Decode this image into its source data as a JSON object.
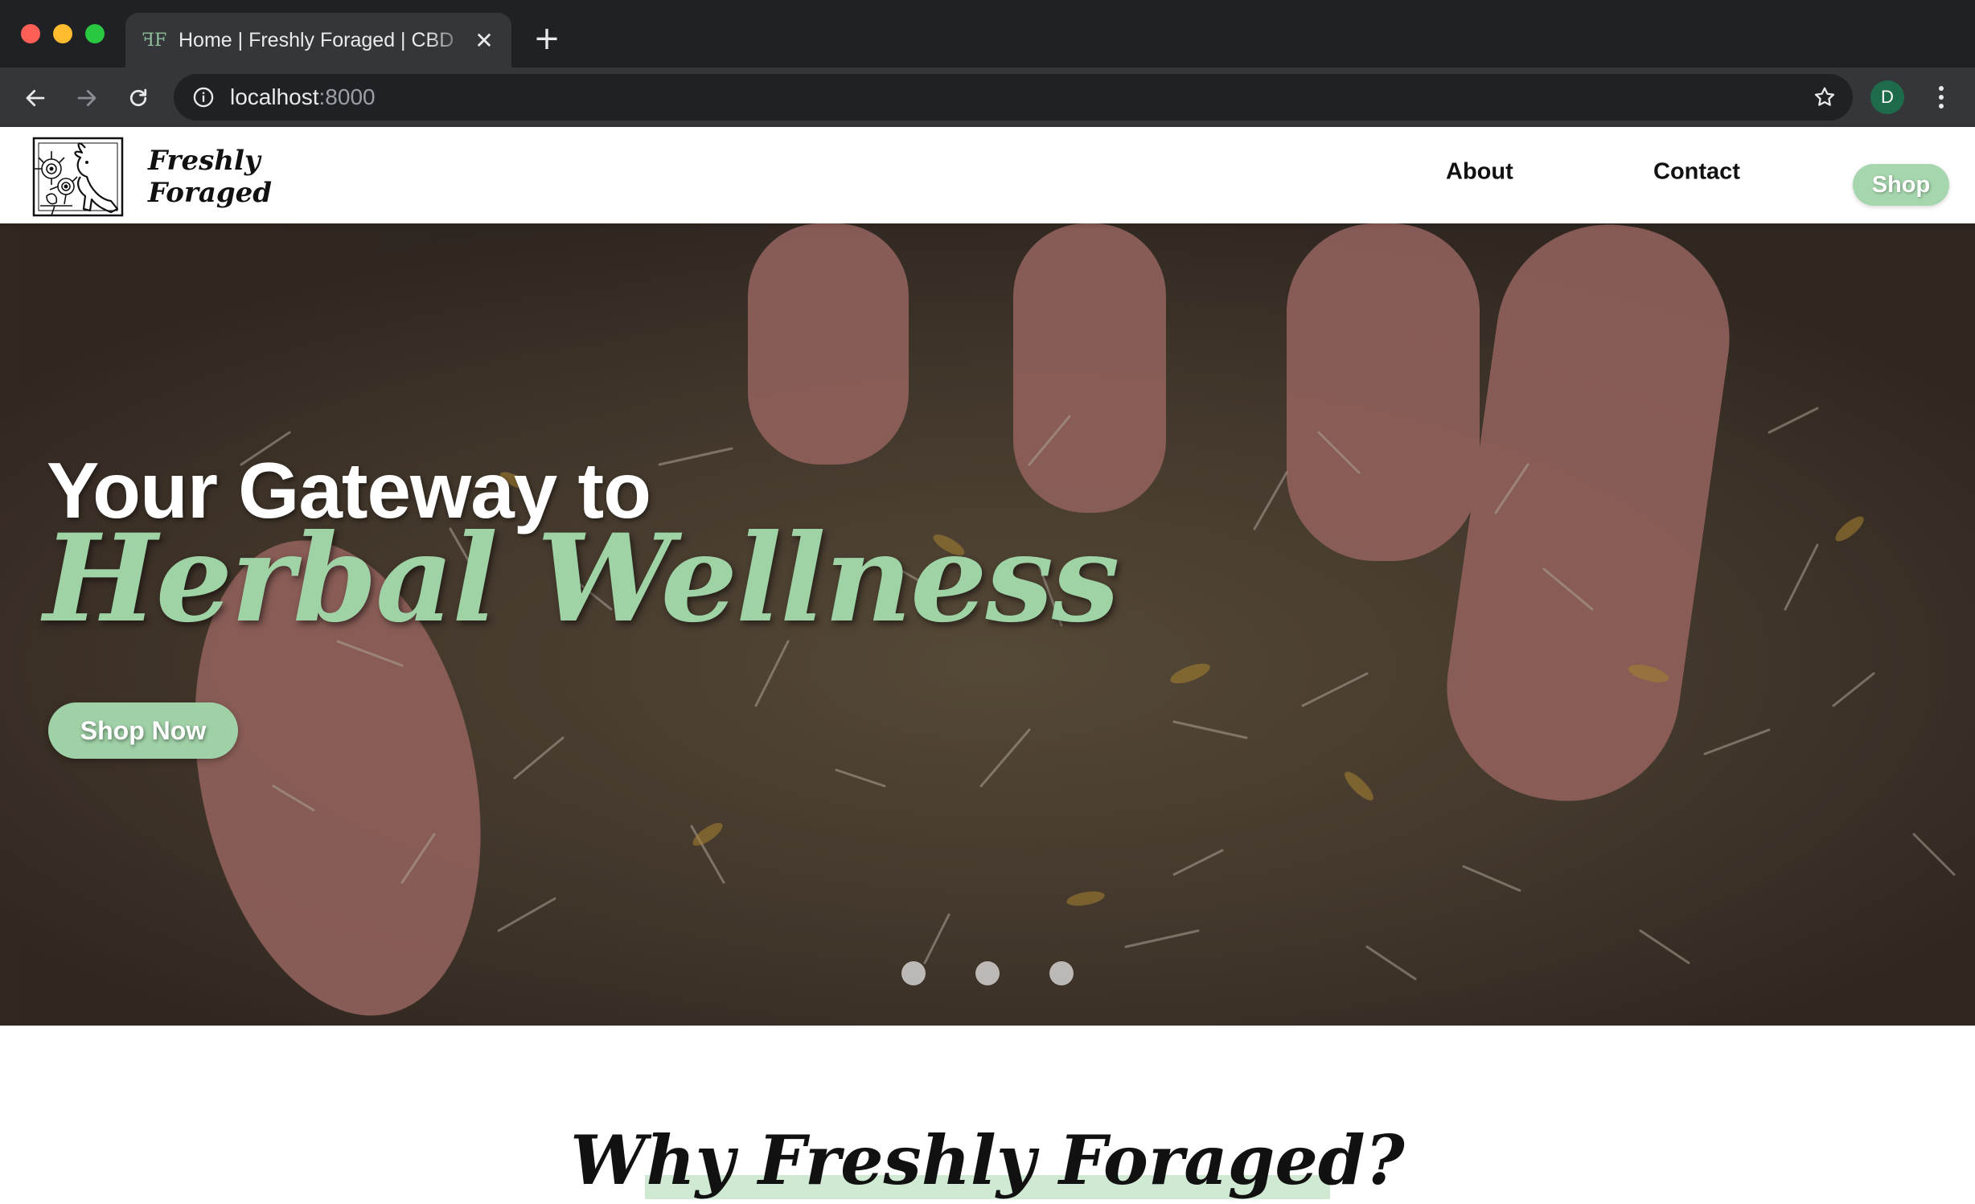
{
  "browser": {
    "tab_title": "Home | Freshly Foraged | CBD",
    "tab_favicon": "ff-logo-icon",
    "tab_close_glyph": "✕",
    "new_tab_glyph": "+",
    "url_host": "localhost",
    "url_port": ":8000",
    "profile_initial": "D",
    "icons": [
      "back-arrow-icon",
      "forward-arrow-icon",
      "reload-icon",
      "info-icon",
      "star-icon",
      "kebab-menu-icon"
    ],
    "colors": {
      "chrome_dark": "#202124",
      "chrome_mid": "#35363a",
      "text": "#e8eaed",
      "avatar": "#1e6b4b"
    }
  },
  "header": {
    "logo_line1": "Freshly",
    "logo_line2": "Foraged",
    "nav": {
      "about": "About",
      "contact": "Contact",
      "shop": "Shop"
    },
    "colors": {
      "accent": "#a6d6ad"
    }
  },
  "hero": {
    "heading": "Your Gateway to",
    "script_heading": "Herbal Wellness",
    "cta": "Shop Now",
    "carousel": {
      "slides": 3
    },
    "colors": {
      "script": "#9fd3a6",
      "cta": "#9fd0a6"
    }
  },
  "why_section": {
    "title": "Why Freshly Foraged?",
    "colors": {
      "highlight": "#cfe9d3"
    }
  }
}
